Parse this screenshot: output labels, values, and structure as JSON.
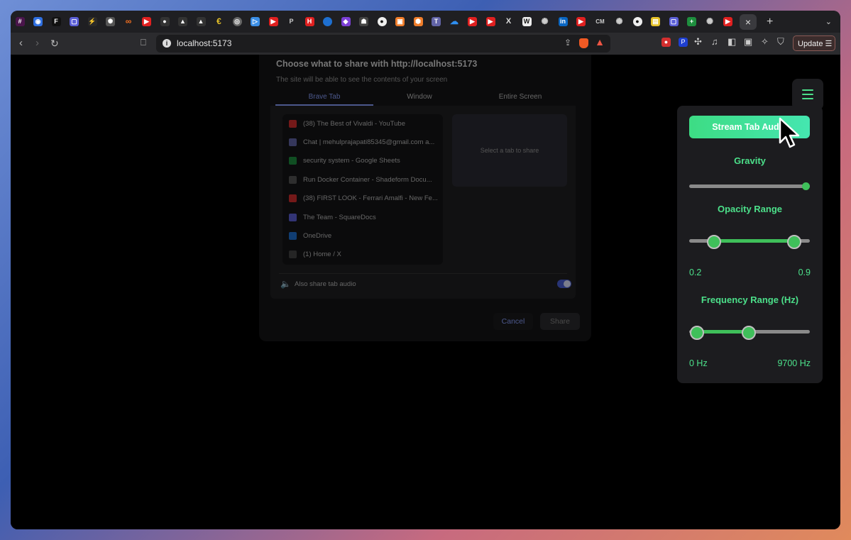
{
  "browser": {
    "tab_icons": [
      "slack-icon",
      "app-icon",
      "framer-icon",
      "docs-icon",
      "alchemy-icon",
      "chatgpt-icon",
      "infinity-icon",
      "youtube-icon",
      "ruby-icon",
      "maze-icon",
      "maze-icon",
      "euro-icon",
      "globe-icon",
      "play-icon",
      "youtube-icon",
      "pinterest-icon",
      "h-icon",
      "edge-icon",
      "leaf-icon",
      "docker-icon",
      "github-icon",
      "box-icon",
      "hexagon-icon",
      "teams-icon",
      "onedrive-icon",
      "youtube-icon",
      "youtube-icon",
      "x-icon",
      "wikipedia-icon",
      "openai-icon",
      "linkedin-icon",
      "youtube-icon",
      "cm-icon",
      "chatgpt-icon",
      "github-icon",
      "image-icon",
      "docs-icon",
      "sheets-icon",
      "chatgpt-icon",
      "youtube-icon"
    ],
    "tab_labels": {
      "cm": "CM",
      "h": "H",
      "in": "in",
      "w": "W"
    },
    "active_tab_close": "×",
    "new_tab": "+",
    "url": "localhost:5173",
    "update_label": "Update"
  },
  "dialog": {
    "title": "Choose what to share with http://localhost:5173",
    "subtitle": "The site will be able to see the contents of your screen",
    "tabs": [
      "Brave Tab",
      "Window",
      "Entire Screen"
    ],
    "items": [
      {
        "label": "(38) The Best of Vivaldi - YouTube",
        "color": "#d32f2f"
      },
      {
        "label": "Chat | mehulprajapati85345@gmail.com a...",
        "color": "#6264a7"
      },
      {
        "label": "security system - Google Sheets",
        "color": "#1e8e3e"
      },
      {
        "label": "Run Docker Container - Shadeform Docu...",
        "color": "#555"
      },
      {
        "label": "(38) FIRST LOOK - Ferrari Amalfi - New Fe...",
        "color": "#d32f2f"
      },
      {
        "label": "The Team - SquareDocs",
        "color": "#5b5fd6"
      },
      {
        "label": "OneDrive",
        "color": "#1e6fd0"
      },
      {
        "label": "(1) Home / X",
        "color": "#444"
      }
    ],
    "preview_text": "Select a tab to share",
    "audio_label": "Also share tab audio",
    "audio_enabled": true,
    "cancel_label": "Cancel",
    "share_label": "Share"
  },
  "panel": {
    "stream_button": "Stream Tab Audio",
    "gravity_label": "Gravity",
    "gravity_value": 1.0,
    "opacity_label": "Opacity Range",
    "opacity_min": "0.2",
    "opacity_max": "0.9",
    "frequency_label": "Frequency Range (Hz)",
    "frequency_min": "0 Hz",
    "frequency_max": "9700 Hz"
  },
  "colors": {
    "accent": "#4ce08a",
    "slider_fill": "#3fbf5a",
    "dialog_accent": "#8aa0ff"
  }
}
